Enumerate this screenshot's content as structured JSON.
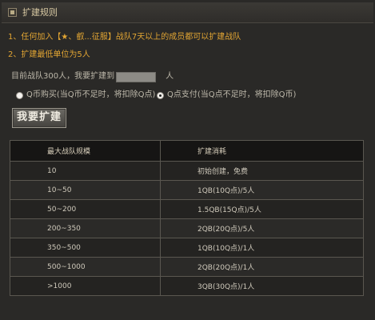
{
  "header": {
    "title": "扩建规则"
  },
  "rules": [
    "1、任何加入【★、叡...征服】战队7天以上的成员都可以扩建战队",
    "2、扩建最低单位为5人"
  ],
  "expand_form": {
    "prefix": "目前战队300人，我要扩建到",
    "input_value": "",
    "unit": "人"
  },
  "payment": {
    "option_qcoin": "Q币购买(当Q币不足时，将扣除Q点)",
    "option_qpoint": "Q点支付(当Q点不足时，将扣除Q币)",
    "selected": "qpoint"
  },
  "submit_button": "我要扩建",
  "table": {
    "headers": [
      "最大战队规模",
      "扩建消耗"
    ],
    "rows": [
      [
        "10",
        "初始创建，免费"
      ],
      [
        "10~50",
        "1QB(10Q点)/5人"
      ],
      [
        "50~200",
        "1.5QB(15Q点)/5人"
      ],
      [
        "200~350",
        "2QB(20Q点)/5人"
      ],
      [
        "350~500",
        "1QB(10Q点)/1人"
      ],
      [
        "500~1000",
        "2QB(20Q点)/1人"
      ],
      [
        ">1000",
        "3QB(30Q点)/1人"
      ]
    ]
  },
  "colors": {
    "rule_text": "#e2a533",
    "background": "#2a2927",
    "table_header_bg": "#161514"
  }
}
